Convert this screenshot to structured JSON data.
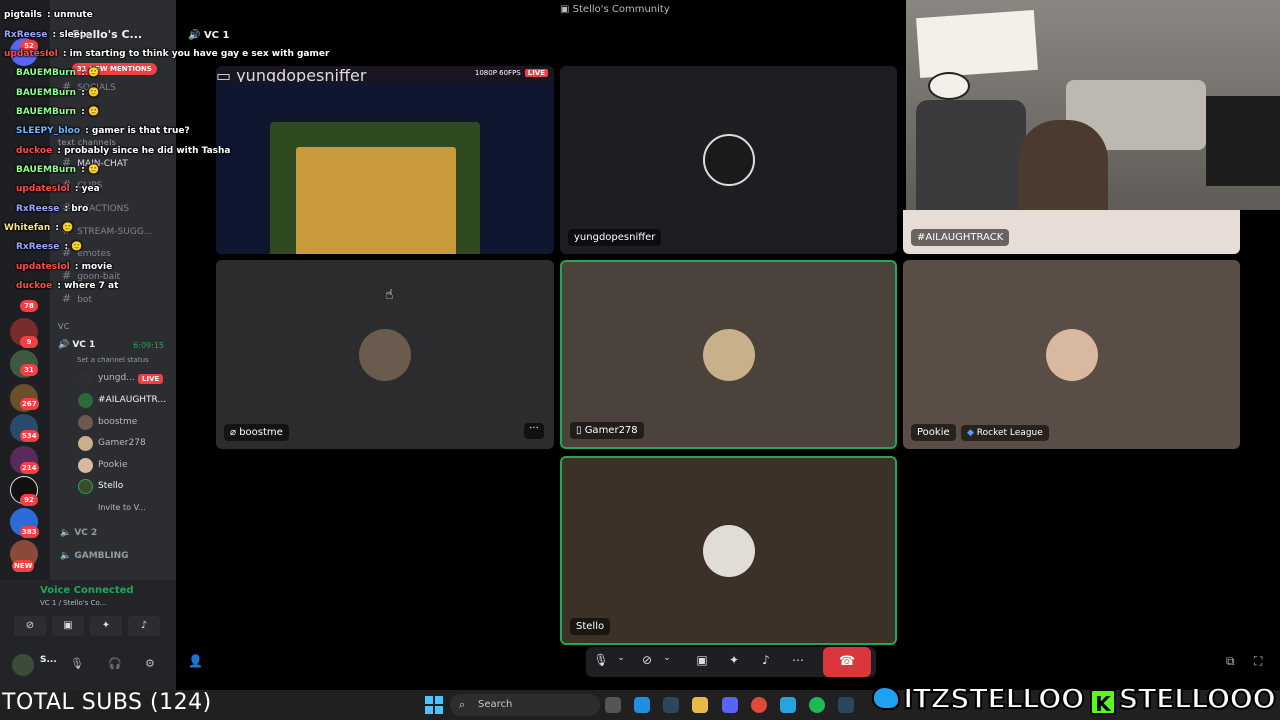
{
  "window": {
    "title": "Stello's Community"
  },
  "server": {
    "name": "Stello's C...",
    "mentions_badge": "31 NEW MENTIONS"
  },
  "channels": {
    "socials": "SOCIALS",
    "text_channels": "text channels",
    "main_chat": "MAIN-CHAT",
    "clips": "CLIPS",
    "reactions": "REACTIONS",
    "stream_suggestions": "STREAM-SUGG...",
    "emotes": "emotes",
    "goon_bait": "goon-bait",
    "bot": "bot",
    "vc_category": "VC",
    "vc1": "VC 1",
    "vc1_timer": "6:09:15",
    "vc1_status": "Set a channel status",
    "vc2": "VC 2",
    "gambling": "GAMBLING"
  },
  "voice_users": [
    {
      "name": "yungd...",
      "live": "LIVE"
    },
    {
      "name": "#AILAUGHTR..."
    },
    {
      "name": "boostme"
    },
    {
      "name": "Gamer278"
    },
    {
      "name": "Pookie"
    },
    {
      "name": "Stello"
    },
    {
      "name": "Invite to V..."
    }
  ],
  "voice_panel": {
    "title": "Voice Connected",
    "subtitle": "VC 1 / Stello's Co..."
  },
  "user_panel": {
    "name": "S..."
  },
  "rail_badges": [
    "52",
    "31",
    "267",
    "534",
    "214",
    "92",
    "383",
    "NEW",
    "78",
    "9"
  ],
  "main_header": {
    "channel": "VC 1"
  },
  "stream": {
    "quality": "1080P 60FPS",
    "live": "LIVE",
    "owner": "yungdopesniffer"
  },
  "tiles": [
    {
      "name": "yungdopesniffer"
    },
    {
      "name": "#AILAUGHTRACK"
    },
    {
      "name": "boostme",
      "menu": "···"
    },
    {
      "name": "Gamer278"
    },
    {
      "name": "Pookie",
      "game": "Rocket League"
    },
    {
      "name": "Stello"
    }
  ],
  "chat": [
    {
      "user": "pigtails",
      "text": "unmute",
      "color": "#ffffff"
    },
    {
      "user": "RxReese",
      "text": "sleep",
      "color": "#9ba8ff"
    },
    {
      "user": "updatesIol",
      "text": "im starting to think you have gay e sex with gamer",
      "color": "#ff4b4b"
    },
    {
      "user": "BAUEMBurn",
      "text": "",
      "color": "#8bff8b"
    },
    {
      "user": "BAUEMBurn",
      "text": "",
      "color": "#8bff8b"
    },
    {
      "user": "BAUEMBurn",
      "text": "",
      "color": "#8bff8b"
    },
    {
      "user": "SLEEPY_bloo",
      "text": "gamer is that true?",
      "color": "#6ab8ff"
    },
    {
      "user": "duckoe",
      "text": "probably since he did with Tasha",
      "color": "#ff4b4b"
    },
    {
      "user": "BAUEMBurn",
      "text": "",
      "color": "#8bff8b"
    },
    {
      "user": "updatesIol",
      "text": "yea",
      "color": "#ff4b4b"
    },
    {
      "user": "RxReese",
      "text": "bro",
      "color": "#9ba8ff"
    },
    {
      "user": "Whitefan",
      "text": "",
      "color": "#ffe082"
    },
    {
      "user": "RxReese",
      "text": "",
      "color": "#9ba8ff"
    },
    {
      "user": "updatesIol",
      "text": "movie",
      "color": "#ff4b4b"
    },
    {
      "user": "duckoe",
      "text": "where 7 at",
      "color": "#ff4b4b"
    }
  ],
  "taskbar": {
    "search_placeholder": "Search"
  },
  "overlay": {
    "subs": "TOTAL SUBS (124)",
    "twitter": "ITZSTELLOO",
    "kick": "STELLOOO",
    "kick_letter": "K"
  },
  "icons": {
    "mic": "microphone-icon",
    "camera": "camera-icon",
    "share": "screen-share-icon",
    "activities": "activities-icon",
    "soundboard": "soundboard-icon",
    "more": "more-icon",
    "hangup": "hangup-icon",
    "popout": "popout-icon",
    "fullscreen": "fullscreen-icon"
  },
  "colors": {
    "speaking": "#23a55a",
    "danger": "#da373c",
    "live": "#f23f43",
    "sidebar": "#2b2d31"
  }
}
